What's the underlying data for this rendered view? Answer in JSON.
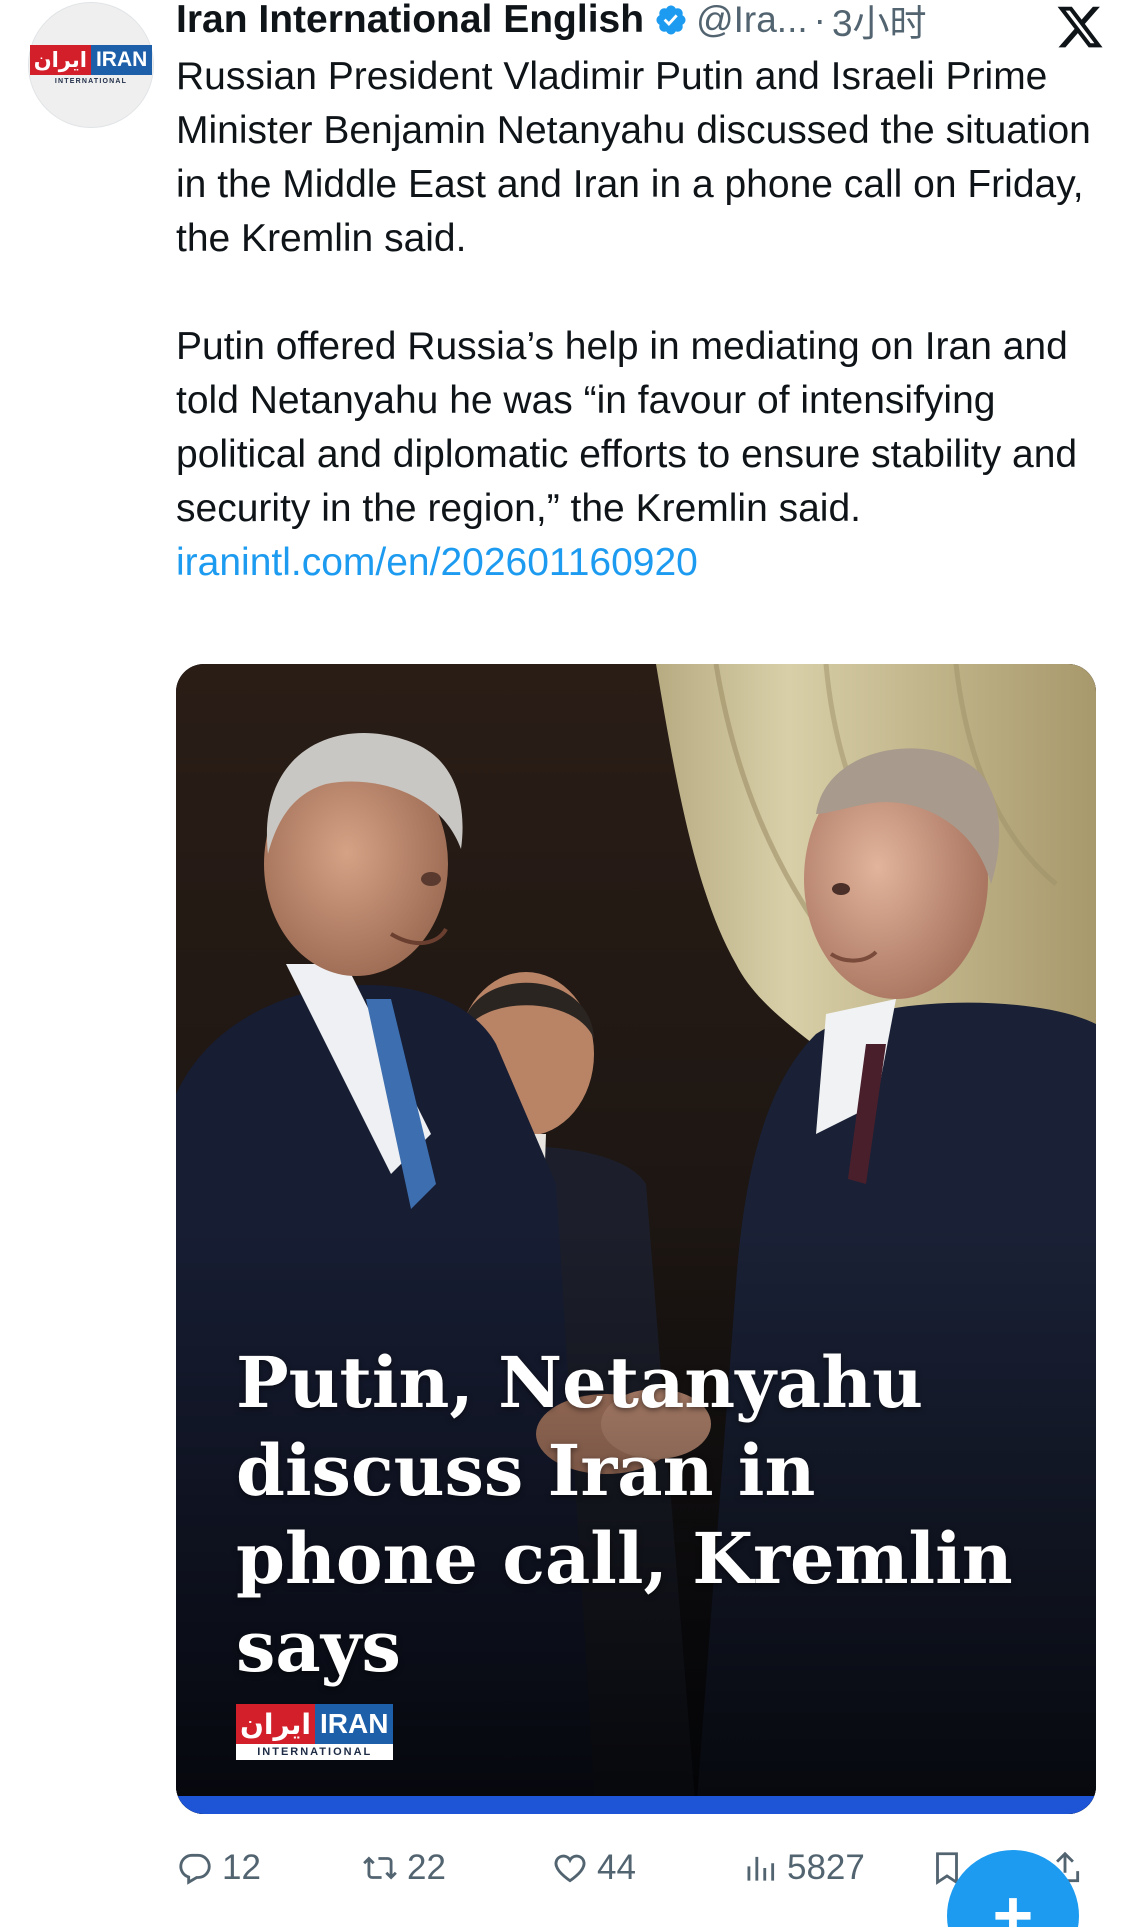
{
  "account": {
    "name": "Iran International English",
    "handle": "@Ira...",
    "separator": "·",
    "time": "3小时"
  },
  "avatar_logo": {
    "persian": "ایران",
    "english": "IRAN",
    "sub": "INTERNATIONAL"
  },
  "tweet": {
    "paragraph_1": "Russian President Vladimir Putin and Israeli Prime Minister Benjamin Netanyahu discussed the situation in the Middle East and Iran in a phone call on Friday, the Kremlin said.",
    "paragraph_2": "Putin offered Russia’s help in mediating on Iran and told Netanyahu he was “in favour of intensifying political and diplomatic efforts to ensure stability and security in the region,” the Kremlin said.",
    "link": "iranintl.com/en/202601160920"
  },
  "media": {
    "headline": "Putin, Netanyahu discuss Iran in phone call, Kremlin says",
    "logo_persian": "ایران",
    "logo_english": "IRAN",
    "logo_sub": "INTERNATIONAL"
  },
  "actions": {
    "replies": "12",
    "reposts": "22",
    "likes": "44",
    "views": "5827"
  },
  "fab_label": "+",
  "colors": {
    "link": "#1d9bf0",
    "secondary_text": "#536471",
    "verified": "#1d9bf0",
    "brand_red": "#d31f2a",
    "brand_blue": "#1d5fa8"
  },
  "icons": [
    "verified-badge-icon",
    "x-logo-icon",
    "reply-icon",
    "repost-icon",
    "like-icon",
    "views-icon",
    "bookmark-icon",
    "share-icon",
    "plus-icon"
  ]
}
